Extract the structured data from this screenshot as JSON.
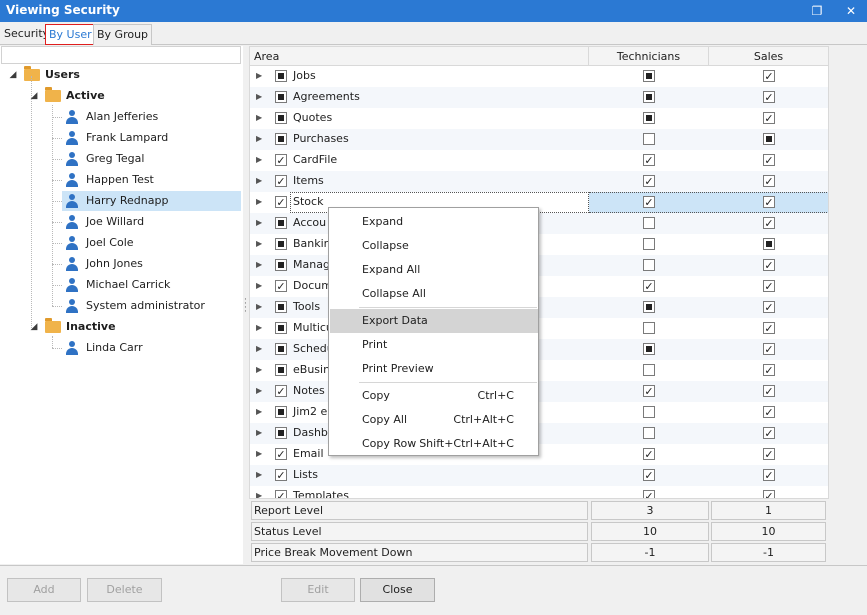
{
  "window": {
    "title": "Viewing Security",
    "restore_icon": "restore-icon",
    "close_icon": "close-icon"
  },
  "tabs": [
    {
      "label": "Security",
      "active": false
    },
    {
      "label": "By User",
      "active": true
    },
    {
      "label": "By Group",
      "active": false
    }
  ],
  "tree": {
    "root": "Users",
    "groups": [
      {
        "label": "Active",
        "users": [
          "Alan Jefferies",
          "Frank Lampard",
          "Greg Tegal",
          "Happen Test",
          "Harry Rednapp",
          "Joe Willard",
          "Joel Cole",
          "John Jones",
          "Michael Carrick",
          "System administrator"
        ]
      },
      {
        "label": "Inactive",
        "users": [
          "Linda Carr"
        ]
      }
    ],
    "selected_user": "Harry Rednapp"
  },
  "grid": {
    "columns": [
      "Area",
      "Technicians",
      "Sales"
    ],
    "rows": [
      {
        "area": "Jobs",
        "area_state": "indeterminate",
        "technicians": "indeterminate",
        "sales": "checked"
      },
      {
        "area": "Agreements",
        "area_state": "indeterminate",
        "technicians": "indeterminate",
        "sales": "checked"
      },
      {
        "area": "Quotes",
        "area_state": "indeterminate",
        "technicians": "indeterminate",
        "sales": "checked"
      },
      {
        "area": "Purchases",
        "area_state": "indeterminate",
        "technicians": "unchecked",
        "sales": "indeterminate"
      },
      {
        "area": "CardFile",
        "area_state": "checked",
        "technicians": "checked",
        "sales": "checked"
      },
      {
        "area": "Items",
        "area_state": "checked",
        "technicians": "checked",
        "sales": "checked"
      },
      {
        "area": "Stock",
        "area_state": "checked",
        "technicians": "checked",
        "sales": "checked"
      },
      {
        "area": "Accou",
        "area_state": "indeterminate",
        "technicians": "unchecked",
        "sales": "checked"
      },
      {
        "area": "Banking",
        "area_state": "indeterminate",
        "technicians": "unchecked",
        "sales": "indeterminate"
      },
      {
        "area": "Manage",
        "area_state": "indeterminate",
        "technicians": "unchecked",
        "sales": "checked"
      },
      {
        "area": "Docume",
        "area_state": "checked",
        "technicians": "checked",
        "sales": "checked"
      },
      {
        "area": "Tools",
        "area_state": "indeterminate",
        "technicians": "indeterminate",
        "sales": "checked"
      },
      {
        "area": "Multicu",
        "area_state": "indeterminate",
        "technicians": "unchecked",
        "sales": "checked"
      },
      {
        "area": "Schedu",
        "area_state": "indeterminate",
        "technicians": "indeterminate",
        "sales": "checked"
      },
      {
        "area": "eBusine",
        "area_state": "indeterminate",
        "technicians": "unchecked",
        "sales": "checked"
      },
      {
        "area": "Notes",
        "area_state": "checked",
        "technicians": "checked",
        "sales": "checked"
      },
      {
        "area": "Jim2 eB",
        "area_state": "indeterminate",
        "technicians": "unchecked",
        "sales": "checked"
      },
      {
        "area": "Dashbo",
        "area_state": "indeterminate",
        "technicians": "unchecked",
        "sales": "checked"
      },
      {
        "area": "Email",
        "area_state": "checked",
        "technicians": "checked",
        "sales": "checked"
      },
      {
        "area": "Lists",
        "area_state": "checked",
        "technicians": "checked",
        "sales": "checked"
      },
      {
        "area": "Templates",
        "area_state": "checked",
        "technicians": "checked",
        "sales": "checked"
      }
    ],
    "selected_row": "Stock"
  },
  "levels": [
    {
      "label": "Report Level",
      "technicians": "3",
      "sales": "1"
    },
    {
      "label": "Status Level",
      "technicians": "10",
      "sales": "10"
    },
    {
      "label": "Price Break Movement Down",
      "technicians": "-1",
      "sales": "-1"
    }
  ],
  "context_menu": {
    "groups": [
      [
        {
          "label": "Expand",
          "shortcut": ""
        },
        {
          "label": "Collapse",
          "shortcut": ""
        },
        {
          "label": "Expand All",
          "shortcut": ""
        },
        {
          "label": "Collapse All",
          "shortcut": ""
        }
      ],
      [
        {
          "label": "Export Data",
          "shortcut": "",
          "hover": true
        },
        {
          "label": "Print",
          "shortcut": ""
        },
        {
          "label": "Print Preview",
          "shortcut": ""
        }
      ],
      [
        {
          "label": "Copy",
          "shortcut": "Ctrl+C"
        },
        {
          "label": "Copy All",
          "shortcut": "Ctrl+Alt+C"
        },
        {
          "label": "Copy Row",
          "shortcut": "Shift+Ctrl+Alt+C"
        }
      ]
    ]
  },
  "buttons": {
    "add": "Add",
    "delete": "Delete",
    "edit": "Edit",
    "close": "Close"
  }
}
